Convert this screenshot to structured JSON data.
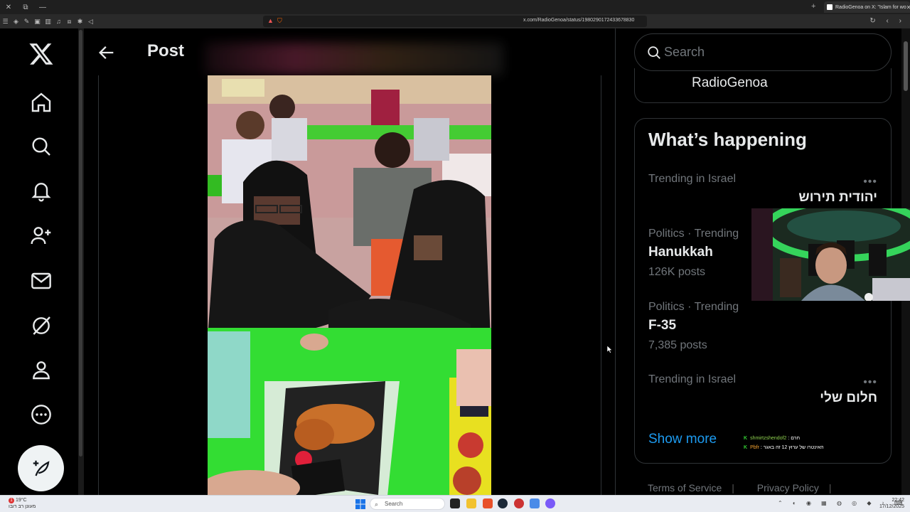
{
  "browser": {
    "tab_title": "RadioGenoa on X: \"Islam for wo",
    "url": "x.com/RadioGenoa/status/1980290172433678830"
  },
  "nav": {
    "items": [
      "x-logo",
      "home",
      "explore",
      "notifications",
      "communities",
      "messages",
      "grok",
      "profile",
      "more"
    ]
  },
  "main": {
    "title": "Post"
  },
  "right": {
    "search_placeholder": "Search",
    "profile_card_name": "RadioGenoa",
    "trends_heading": "What’s happening",
    "trends": [
      {
        "context": "Trending in Israel",
        "title": "יהודית תירוש",
        "count": "",
        "rtl": true
      },
      {
        "context": "Politics · Trending",
        "title": "Hanukkah",
        "count": "126K posts",
        "rtl": false
      },
      {
        "context": "Politics · Trending",
        "title": "F-35",
        "count": "7,385 posts",
        "rtl": false
      },
      {
        "context": "Trending in Israel",
        "title": "חלום שלי",
        "count": "",
        "rtl": true
      }
    ],
    "show_more": "Show more",
    "footer": [
      "Terms of Service",
      "Privacy Policy"
    ]
  },
  "chat": [
    {
      "user": "shmirtzshendof2",
      "text": ": חרם"
    },
    {
      "user": "Pbfr",
      "text": ": האינטרו של ערוץ 12 זה באגר"
    }
  ],
  "taskbar": {
    "weather_temp": "19°C",
    "weather_desc": "מעונן רב רובו",
    "search_label": "Search",
    "time": "22:42",
    "date": "17/12/2025",
    "lang": "עבר"
  },
  "colors": {
    "accent": "#1d9bf0",
    "text_primary": "#e7e9ea",
    "text_secondary": "#71767b",
    "border": "#2f3336"
  }
}
